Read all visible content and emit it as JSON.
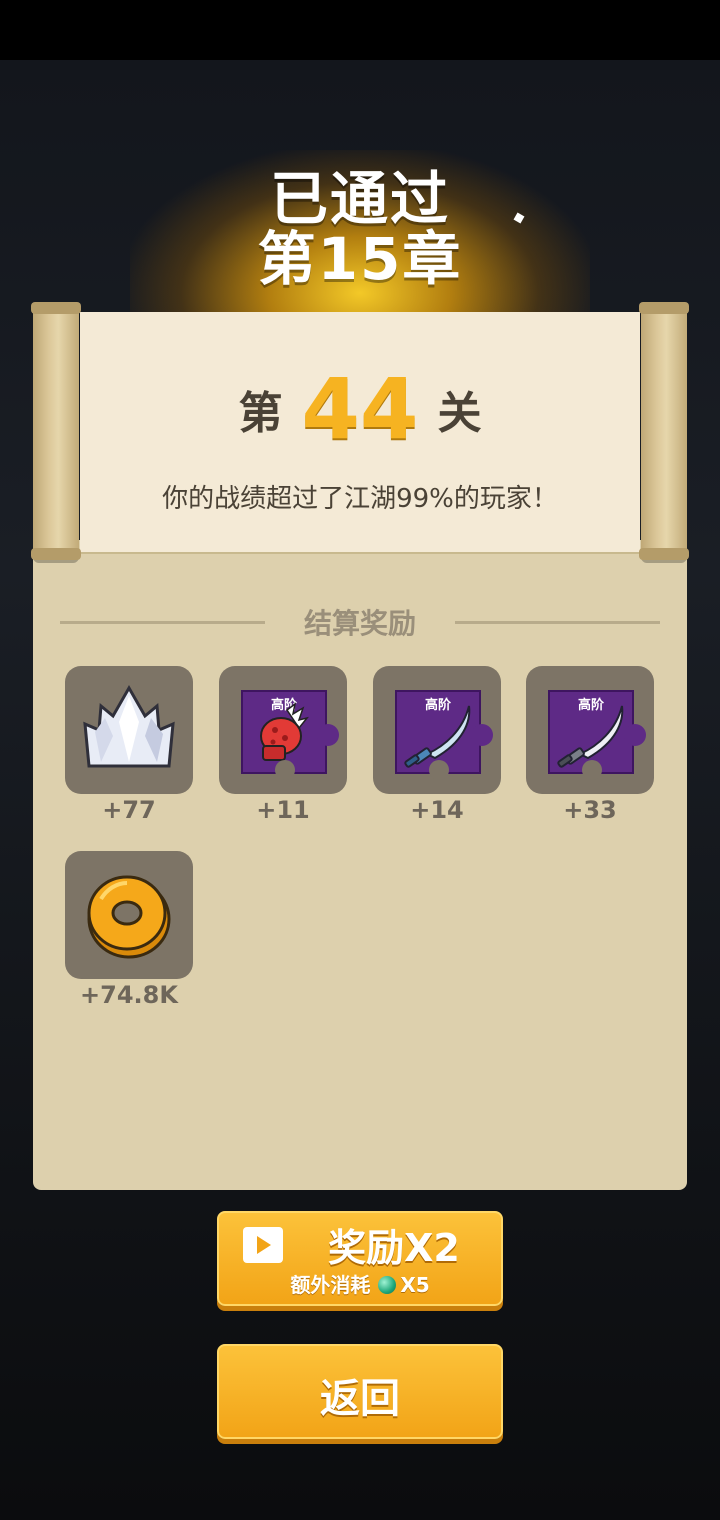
{
  "header": {
    "title_line1": "已通过",
    "title_line2": "第15章"
  },
  "level": {
    "prefix": "第",
    "number": "44",
    "suffix": "关",
    "subtitle": "你的战绩超过了江湖99%的玩家！"
  },
  "rewards": {
    "section_title": "结算奖励",
    "items": [
      {
        "icon": "crystal-icon",
        "badge": "",
        "amount": "+77"
      },
      {
        "icon": "boxing-glove-card-icon",
        "badge": "高阶",
        "amount": "+11"
      },
      {
        "icon": "blue-sabre-card-icon",
        "badge": "高阶",
        "amount": "+14"
      },
      {
        "icon": "silver-sabre-card-icon",
        "badge": "高阶",
        "amount": "+33"
      },
      {
        "icon": "gold-coin-icon",
        "badge": "",
        "amount": "+74.8K"
      }
    ]
  },
  "buttons": {
    "double_label": "奖励X2",
    "double_cost_label": "额外消耗",
    "double_cost_value": "X5",
    "back_label": "返回"
  },
  "colors": {
    "accent": "#f6b321",
    "button": "#f2a417",
    "panel": "#ddd0ad",
    "paper": "#f4ead6",
    "card_purple": "#5e2a86"
  }
}
